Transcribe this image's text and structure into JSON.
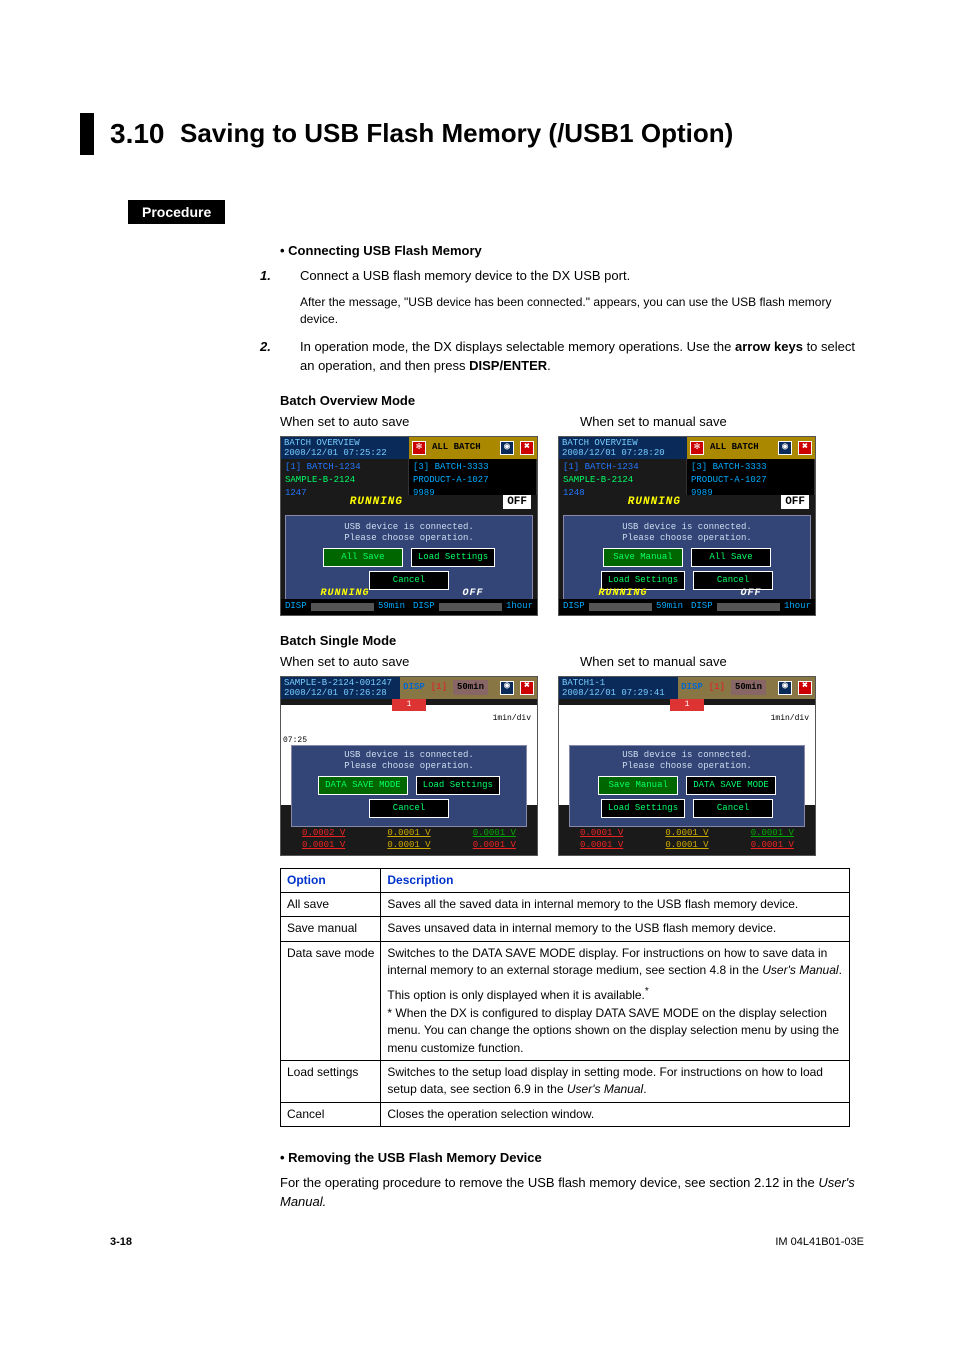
{
  "section": {
    "number": "3.10",
    "title": "Saving to USB Flash Memory (/USB1 Option)"
  },
  "procedure_label": "Procedure",
  "connecting": {
    "heading": "Connecting USB Flash Memory",
    "step1": "Connect a USB flash memory device to the DX USB port.",
    "step1_sub": "After the message, \"USB device has been connected.\" appears, you can use the USB flash memory device.",
    "step2_a": "In operation mode, the DX displays selectable memory operations. Use the ",
    "step2_b": "arrow keys",
    "step2_c": " to select an operation, and then press ",
    "step2_d": "DISP/ENTER",
    "step2_e": "."
  },
  "batch_overview": {
    "heading": "Batch Overview Mode",
    "auto_caption": "When set to auto save",
    "manual_caption": "When set to manual save",
    "title": "BATCH OVERVIEW",
    "ts_auto": "2008/12/01 07:25:22",
    "ts_manual": "2008/12/01 07:28:20",
    "banner": "ALL BATCH",
    "col1_h": "[1] BATCH-1234",
    "col1_a": "SAMPLE-B-2124",
    "col1_b_auto": "1247",
    "col1_b_manual": "1248",
    "col2_h": "[3] BATCH-3333",
    "col2_a": "PRODUCT-A-1027",
    "col2_b": "9989",
    "running": "RUNNING",
    "off": "OFF",
    "msg1": "USB device is connected.",
    "msg2": "Please choose operation.",
    "auto_btns": [
      "All Save",
      "Load Settings",
      "Cancel"
    ],
    "manual_btns": [
      "Save Manual",
      "All Save",
      "Load Settings",
      "Cancel"
    ],
    "disp": "DISP",
    "ftime1": "59min",
    "ftime2": "1hour"
  },
  "batch_single": {
    "heading": "Batch Single Mode",
    "auto_caption": "When set to auto save",
    "manual_caption": "When set to manual save",
    "title_auto": "SAMPLE-B-2124-001247",
    "title_manual": "BATCH1-1",
    "ts_auto": "2008/12/01 07:26:28",
    "ts_manual": "2008/12/01 07:29:41",
    "disp_lbl": "DISP",
    "tab": "[1]",
    "rate": "50min",
    "axis": "1min/div",
    "redtab": "1",
    "time_lbl": "07:25",
    "msg1": "USB device is connected.",
    "msg2": "Please choose operation.",
    "auto_btns": [
      "DATA SAVE MODE",
      "Load Settings",
      "Cancel"
    ],
    "manual_btns": [
      "Save Manual",
      "DATA SAVE MODE",
      "Load Settings",
      "Cancel"
    ],
    "vals_auto_top": [
      "0.0002 V",
      "0.0001 V",
      "0.0001 V"
    ],
    "vals_auto_bot": [
      "0.0001 V",
      "0.0001 V",
      "0.0001 V"
    ],
    "vals_man_top": [
      "0.0001 V",
      "0.0001 V",
      "0.0001 V"
    ],
    "vals_man_bot": [
      "0.0001 V",
      "0.0001 V",
      "0.0001 V"
    ]
  },
  "table": {
    "h_option": "Option",
    "h_desc": "Description",
    "rows": [
      {
        "opt": "All save",
        "desc": "Saves all the saved data in internal memory to the USB flash memory device."
      },
      {
        "opt": "Save manual",
        "desc": "Saves unsaved data in internal memory to the USB flash memory device."
      },
      {
        "opt": "Data save mode",
        "desc_a": "Switches to the DATA SAVE MODE display. For instructions on how to save data in internal memory to an external storage medium, see section 4.8 in the ",
        "desc_em": "User's Manual",
        "desc_b": ".",
        "extra1": "This option is only displayed when it is available.",
        "extra_star": "*",
        "extra2": "* When the DX is configured to display DATA SAVE MODE on the display selection menu. You can change the options shown on the display selection menu by using the menu customize function."
      },
      {
        "opt": "Load settings",
        "desc_a": "Switches to the setup load display in setting mode. For instructions on how to load setup data, see section 6.9 in the ",
        "desc_em": "User's Manual",
        "desc_b": "."
      },
      {
        "opt": "Cancel",
        "desc": "Closes the operation selection window."
      }
    ]
  },
  "removing": {
    "heading": "Removing the USB Flash Memory Device",
    "body_a": "For the operating procedure to remove the USB flash memory device, see section 2.12 in the ",
    "body_em": "User's Manual.",
    "body_b": ""
  },
  "footer": {
    "page": "3-18",
    "doc": "IM 04L41B01-03E"
  }
}
